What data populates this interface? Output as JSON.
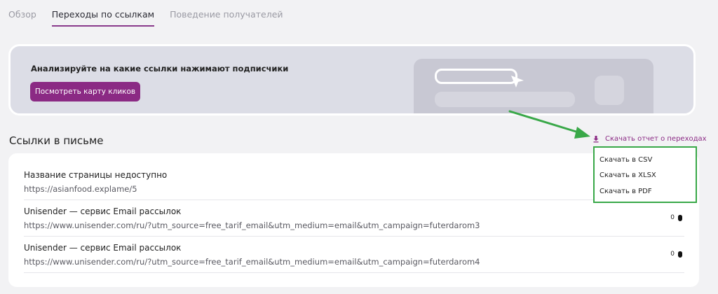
{
  "tabs": [
    {
      "label": "Обзор",
      "active": false
    },
    {
      "label": "Переходы по ссылкам",
      "active": true
    },
    {
      "label": "Поведение получателей",
      "active": false
    }
  ],
  "banner": {
    "text": "Анализируйте на какие ссылки нажимают подписчики",
    "button_label": "Посмотреть карту кликов"
  },
  "section": {
    "title": "Ссылки в письме",
    "report_link_label": "Скачать отчет о переходах"
  },
  "download_menu": {
    "items": [
      "Скачать в CSV",
      "Скачать в XLSX",
      "Скачать в PDF"
    ]
  },
  "links": [
    {
      "title": "Название страницы недоступно",
      "url": "https://asianfood.explame/5",
      "clicks": ""
    },
    {
      "title": "Unisender — сервис Email рассылок",
      "url": "https://www.unisender.com/ru/?utm_source=free_tarif_email&utm_medium=email&utm_campaign=futerdarom3",
      "clicks": "0"
    },
    {
      "title": "Unisender — сервис Email рассылок",
      "url": "https://www.unisender.com/ru/?utm_source=free_tarif_email&utm_medium=email&utm_campaign=futerdarom4",
      "clicks": "0"
    }
  ],
  "colors": {
    "accent": "#8b2a84",
    "highlight": "#39a848",
    "background": "#f2f2f4"
  },
  "icons": [
    "download-icon",
    "mouse-icon",
    "cursor-icon"
  ]
}
